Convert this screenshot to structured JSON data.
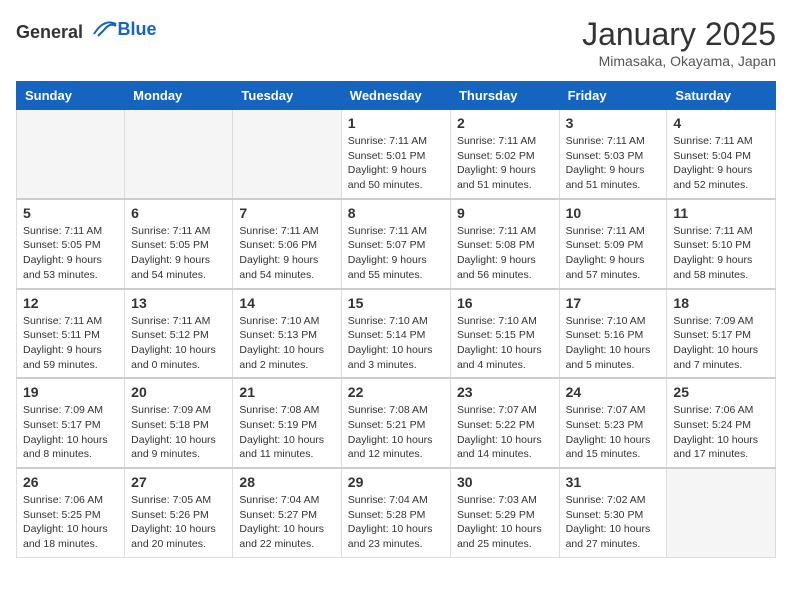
{
  "header": {
    "logo_general": "General",
    "logo_blue": "Blue",
    "month_title": "January 2025",
    "location": "Mimasaka, Okayama, Japan"
  },
  "weekdays": [
    "Sunday",
    "Monday",
    "Tuesday",
    "Wednesday",
    "Thursday",
    "Friday",
    "Saturday"
  ],
  "weeks": [
    [
      {
        "day": "",
        "info": ""
      },
      {
        "day": "",
        "info": ""
      },
      {
        "day": "",
        "info": ""
      },
      {
        "day": "1",
        "info": "Sunrise: 7:11 AM\nSunset: 5:01 PM\nDaylight: 9 hours\nand 50 minutes."
      },
      {
        "day": "2",
        "info": "Sunrise: 7:11 AM\nSunset: 5:02 PM\nDaylight: 9 hours\nand 51 minutes."
      },
      {
        "day": "3",
        "info": "Sunrise: 7:11 AM\nSunset: 5:03 PM\nDaylight: 9 hours\nand 51 minutes."
      },
      {
        "day": "4",
        "info": "Sunrise: 7:11 AM\nSunset: 5:04 PM\nDaylight: 9 hours\nand 52 minutes."
      }
    ],
    [
      {
        "day": "5",
        "info": "Sunrise: 7:11 AM\nSunset: 5:05 PM\nDaylight: 9 hours\nand 53 minutes."
      },
      {
        "day": "6",
        "info": "Sunrise: 7:11 AM\nSunset: 5:05 PM\nDaylight: 9 hours\nand 54 minutes."
      },
      {
        "day": "7",
        "info": "Sunrise: 7:11 AM\nSunset: 5:06 PM\nDaylight: 9 hours\nand 54 minutes."
      },
      {
        "day": "8",
        "info": "Sunrise: 7:11 AM\nSunset: 5:07 PM\nDaylight: 9 hours\nand 55 minutes."
      },
      {
        "day": "9",
        "info": "Sunrise: 7:11 AM\nSunset: 5:08 PM\nDaylight: 9 hours\nand 56 minutes."
      },
      {
        "day": "10",
        "info": "Sunrise: 7:11 AM\nSunset: 5:09 PM\nDaylight: 9 hours\nand 57 minutes."
      },
      {
        "day": "11",
        "info": "Sunrise: 7:11 AM\nSunset: 5:10 PM\nDaylight: 9 hours\nand 58 minutes."
      }
    ],
    [
      {
        "day": "12",
        "info": "Sunrise: 7:11 AM\nSunset: 5:11 PM\nDaylight: 9 hours\nand 59 minutes."
      },
      {
        "day": "13",
        "info": "Sunrise: 7:11 AM\nSunset: 5:12 PM\nDaylight: 10 hours\nand 0 minutes."
      },
      {
        "day": "14",
        "info": "Sunrise: 7:10 AM\nSunset: 5:13 PM\nDaylight: 10 hours\nand 2 minutes."
      },
      {
        "day": "15",
        "info": "Sunrise: 7:10 AM\nSunset: 5:14 PM\nDaylight: 10 hours\nand 3 minutes."
      },
      {
        "day": "16",
        "info": "Sunrise: 7:10 AM\nSunset: 5:15 PM\nDaylight: 10 hours\nand 4 minutes."
      },
      {
        "day": "17",
        "info": "Sunrise: 7:10 AM\nSunset: 5:16 PM\nDaylight: 10 hours\nand 5 minutes."
      },
      {
        "day": "18",
        "info": "Sunrise: 7:09 AM\nSunset: 5:17 PM\nDaylight: 10 hours\nand 7 minutes."
      }
    ],
    [
      {
        "day": "19",
        "info": "Sunrise: 7:09 AM\nSunset: 5:17 PM\nDaylight: 10 hours\nand 8 minutes."
      },
      {
        "day": "20",
        "info": "Sunrise: 7:09 AM\nSunset: 5:18 PM\nDaylight: 10 hours\nand 9 minutes."
      },
      {
        "day": "21",
        "info": "Sunrise: 7:08 AM\nSunset: 5:19 PM\nDaylight: 10 hours\nand 11 minutes."
      },
      {
        "day": "22",
        "info": "Sunrise: 7:08 AM\nSunset: 5:21 PM\nDaylight: 10 hours\nand 12 minutes."
      },
      {
        "day": "23",
        "info": "Sunrise: 7:07 AM\nSunset: 5:22 PM\nDaylight: 10 hours\nand 14 minutes."
      },
      {
        "day": "24",
        "info": "Sunrise: 7:07 AM\nSunset: 5:23 PM\nDaylight: 10 hours\nand 15 minutes."
      },
      {
        "day": "25",
        "info": "Sunrise: 7:06 AM\nSunset: 5:24 PM\nDaylight: 10 hours\nand 17 minutes."
      }
    ],
    [
      {
        "day": "26",
        "info": "Sunrise: 7:06 AM\nSunset: 5:25 PM\nDaylight: 10 hours\nand 18 minutes."
      },
      {
        "day": "27",
        "info": "Sunrise: 7:05 AM\nSunset: 5:26 PM\nDaylight: 10 hours\nand 20 minutes."
      },
      {
        "day": "28",
        "info": "Sunrise: 7:04 AM\nSunset: 5:27 PM\nDaylight: 10 hours\nand 22 minutes."
      },
      {
        "day": "29",
        "info": "Sunrise: 7:04 AM\nSunset: 5:28 PM\nDaylight: 10 hours\nand 23 minutes."
      },
      {
        "day": "30",
        "info": "Sunrise: 7:03 AM\nSunset: 5:29 PM\nDaylight: 10 hours\nand 25 minutes."
      },
      {
        "day": "31",
        "info": "Sunrise: 7:02 AM\nSunset: 5:30 PM\nDaylight: 10 hours\nand 27 minutes."
      },
      {
        "day": "",
        "info": ""
      }
    ]
  ]
}
